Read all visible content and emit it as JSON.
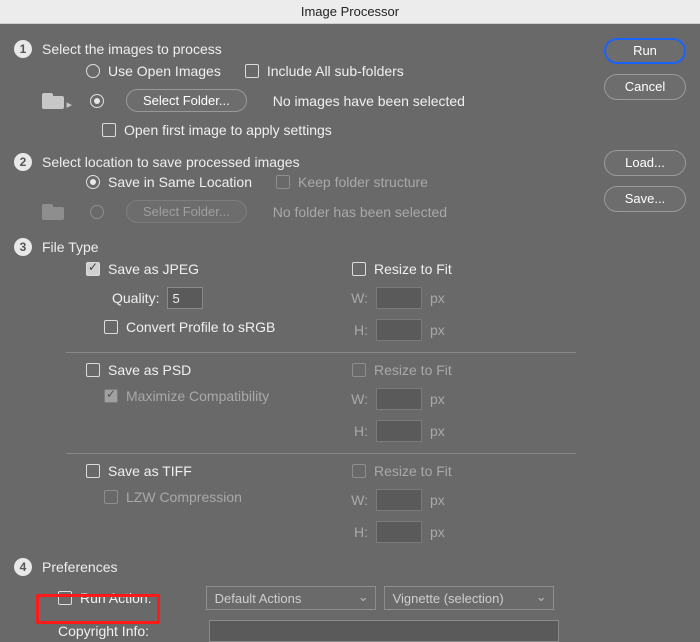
{
  "window": {
    "title": "Image Processor"
  },
  "buttons": {
    "run": "Run",
    "cancel": "Cancel",
    "load": "Load...",
    "save": "Save..."
  },
  "section1": {
    "title": "Select the images to process",
    "use_open_images": "Use Open Images",
    "include_subfolders": "Include All sub-folders",
    "select_folder_btn": "Select Folder...",
    "no_images_msg": "No images have been selected",
    "open_first": "Open first image to apply settings"
  },
  "section2": {
    "title": "Select location to save processed images",
    "save_same": "Save in Same Location",
    "keep_structure": "Keep folder structure",
    "select_folder_btn": "Select Folder...",
    "no_folder_msg": "No folder has been selected"
  },
  "section3": {
    "title": "File Type",
    "jpeg": {
      "label": "Save as JPEG",
      "quality_label": "Quality:",
      "quality_value": "5",
      "convert_srgb": "Convert Profile to sRGB",
      "resize": "Resize to Fit",
      "w": "W:",
      "h": "H:",
      "px": "px"
    },
    "psd": {
      "label": "Save as PSD",
      "maximize": "Maximize Compatibility",
      "resize": "Resize to Fit",
      "w": "W:",
      "h": "H:",
      "px": "px"
    },
    "tiff": {
      "label": "Save as TIFF",
      "lzw": "LZW Compression",
      "resize": "Resize to Fit",
      "w": "W:",
      "h": "H:",
      "px": "px"
    }
  },
  "section4": {
    "title": "Preferences",
    "run_action": "Run Action:",
    "action_set": "Default Actions",
    "action": "Vignette (selection)",
    "copyright_label": "Copyright Info:"
  }
}
